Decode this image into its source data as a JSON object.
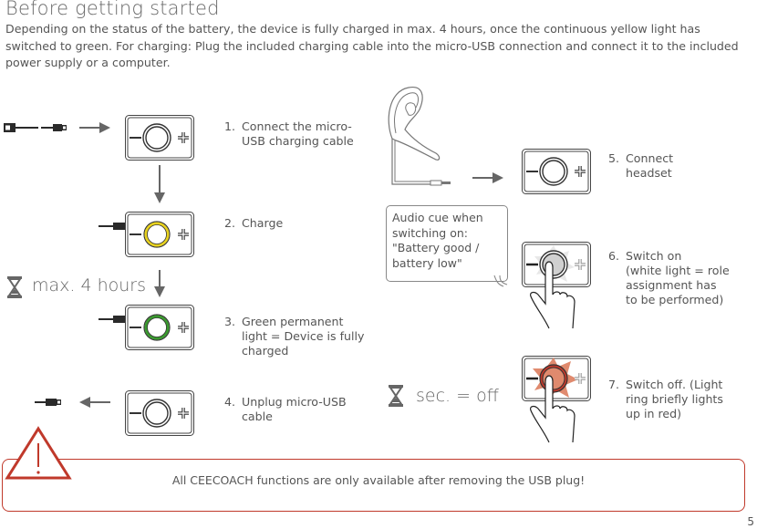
{
  "page": {
    "title": "Before getting started",
    "intro": "Depending on the status of the battery, the device is fully charged in max. 4 hours, once the continuous yellow light has switched to green. For charging: Plug the included charging cable into the micro-USB connection and connect it to the included power supply or a computer.",
    "page_number": "5"
  },
  "steps": [
    {
      "num": "1.",
      "text": "Connect the micro-\nUSB charging cable",
      "ring": "none"
    },
    {
      "num": "2.",
      "text": "Charge",
      "ring": "yellow"
    },
    {
      "num": "3.",
      "text": "Green permanent\nlight = Device is fully\ncharged",
      "ring": "green"
    },
    {
      "num": "4.",
      "text": "Unplug micro-USB\ncable",
      "ring": "none"
    },
    {
      "num": "5.",
      "text": "Connect\nheadset",
      "ring": "none"
    },
    {
      "num": "6.",
      "text": "Switch on\n (white light = role\nassignment has\nto be performed)",
      "ring": "white"
    },
    {
      "num": "7.",
      "text": "Switch off. (Light\nring briefly lights\n up in red)",
      "ring": "red"
    }
  ],
  "timers": {
    "charge": "max. 4 hours",
    "off": "sec. = off"
  },
  "bubble": "Audio cue when switching on: \"Battery good / battery low\"",
  "warning": {
    "text": "All CEECOACH functions are only available after removing the USB plug!",
    "icon": "warning-triangle-icon"
  },
  "colors": {
    "yellow_ring": "#e8d21e",
    "green_ring": "#3a9a2e",
    "red_ring": "#c0392b",
    "red_fill": "#e08a6e",
    "warning": "#c0392b",
    "line": "#555555"
  },
  "icons": {
    "hourglass": "hourglass-icon",
    "arrow": "arrow-icon",
    "usb": "usb-cable-icon",
    "headset": "headset-icon",
    "hand": "hand-press-icon",
    "device": "device-icon"
  }
}
